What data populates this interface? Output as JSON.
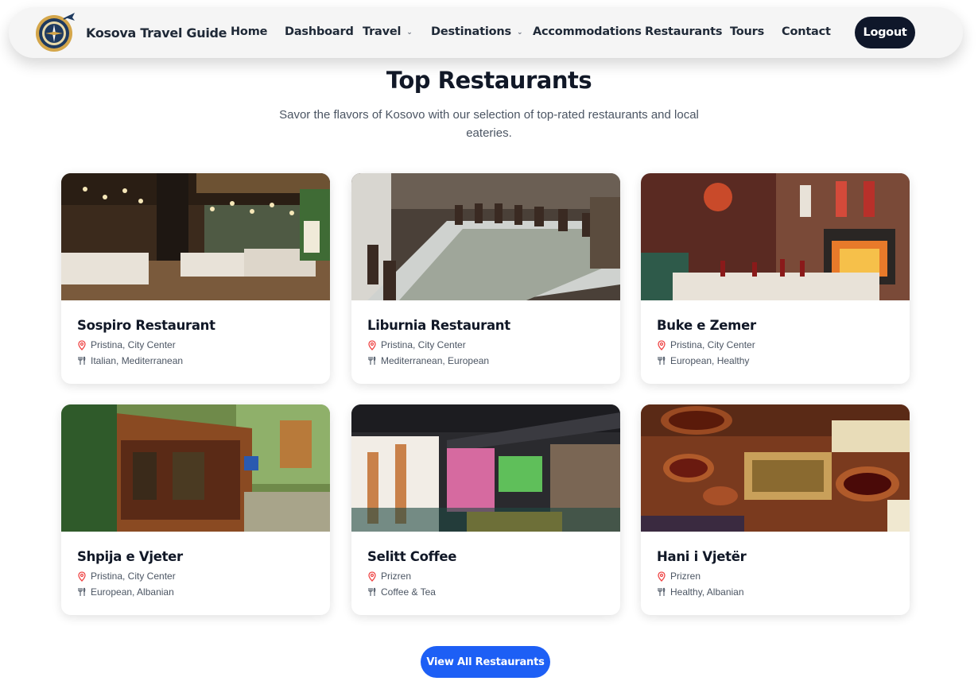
{
  "header": {
    "brand": "Kosova Travel Guide",
    "nav": [
      {
        "label": "Home",
        "dropdown": false
      },
      {
        "label": "Dashboard",
        "dropdown": false
      },
      {
        "label": "Travel",
        "dropdown": true
      },
      {
        "label": "Destinations",
        "dropdown": true
      },
      {
        "label": "Accommodations",
        "dropdown": false
      },
      {
        "label": "Restaurants",
        "dropdown": false
      },
      {
        "label": "Tours",
        "dropdown": false
      },
      {
        "label": "Contact",
        "dropdown": false
      }
    ],
    "logout_label": "Logout"
  },
  "main": {
    "title": "Top Restaurants",
    "subtitle": "Savor the flavors of Kosovo with our selection of top-rated restaurants and local eateries.",
    "restaurants": [
      {
        "name": "Sospiro Restaurant",
        "location": "Pristina, City Center",
        "cuisine": "Italian, Mediterranean",
        "photo": "restaurant-interior-photo"
      },
      {
        "name": "Liburnia Restaurant",
        "location": "Pristina, City Center",
        "cuisine": "Mediterranean, European",
        "photo": "banquet-table-photo"
      },
      {
        "name": "Buke e Zemer",
        "location": "Pristina, City Center",
        "cuisine": "European, Healthy",
        "photo": "fireplace-dining-photo"
      },
      {
        "name": "Shpija e Vjeter",
        "location": "Pristina, City Center",
        "cuisine": "European, Albanian",
        "photo": "wooden-house-terrace-photo"
      },
      {
        "name": "Selitt Coffee",
        "location": "Prizren",
        "cuisine": "Coffee & Tea",
        "photo": "cafe-interior-photo"
      },
      {
        "name": "Hani i Vjetër",
        "location": "Prizren",
        "cuisine": "Healthy, Albanian",
        "photo": "traditional-food-platter-photo"
      }
    ],
    "view_all_label": "View All Restaurants"
  },
  "colors": {
    "accent": "#1d5ff5",
    "dark_button": "#0f172a",
    "location_icon": "#ef4444"
  },
  "icons": [
    "compass-logo-icon",
    "chevron-down-icon",
    "map-pin-icon",
    "utensils-icon"
  ]
}
